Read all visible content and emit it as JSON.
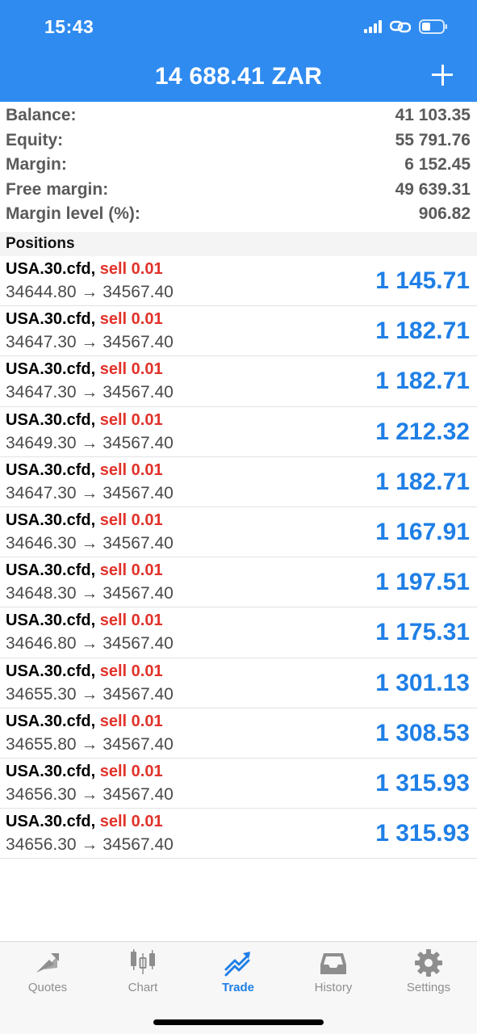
{
  "status_bar": {
    "time": "15:43"
  },
  "header": {
    "title": "14 688.41 ZAR",
    "add_icon": "plus-icon"
  },
  "summary": [
    {
      "label": "Balance:",
      "value": "41 103.35"
    },
    {
      "label": "Equity:",
      "value": "55 791.76"
    },
    {
      "label": "Margin:",
      "value": "6 152.45"
    },
    {
      "label": "Free margin:",
      "value": "49 639.31"
    },
    {
      "label": "Margin level (%):",
      "value": "906.82"
    }
  ],
  "positions_header": "Positions",
  "positions": [
    {
      "symbol": "USA.30.cfd,",
      "side": "sell 0.01",
      "prices": "34644.80 → 34567.40",
      "profit": "1 145.71"
    },
    {
      "symbol": "USA.30.cfd,",
      "side": "sell 0.01",
      "prices": "34647.30 → 34567.40",
      "profit": "1 182.71"
    },
    {
      "symbol": "USA.30.cfd,",
      "side": "sell 0.01",
      "prices": "34647.30 → 34567.40",
      "profit": "1 182.71"
    },
    {
      "symbol": "USA.30.cfd,",
      "side": "sell 0.01",
      "prices": "34649.30 → 34567.40",
      "profit": "1 212.32"
    },
    {
      "symbol": "USA.30.cfd,",
      "side": "sell 0.01",
      "prices": "34647.30 → 34567.40",
      "profit": "1 182.71"
    },
    {
      "symbol": "USA.30.cfd,",
      "side": "sell 0.01",
      "prices": "34646.30 → 34567.40",
      "profit": "1 167.91"
    },
    {
      "symbol": "USA.30.cfd,",
      "side": "sell 0.01",
      "prices": "34648.30 → 34567.40",
      "profit": "1 197.51"
    },
    {
      "symbol": "USA.30.cfd,",
      "side": "sell 0.01",
      "prices": "34646.80 → 34567.40",
      "profit": "1 175.31"
    },
    {
      "symbol": "USA.30.cfd,",
      "side": "sell 0.01",
      "prices": "34655.30 → 34567.40",
      "profit": "1 301.13"
    },
    {
      "symbol": "USA.30.cfd,",
      "side": "sell 0.01",
      "prices": "34655.80 → 34567.40",
      "profit": "1 308.53"
    },
    {
      "symbol": "USA.30.cfd,",
      "side": "sell 0.01",
      "prices": "34656.30 → 34567.40",
      "profit": "1 315.93"
    },
    {
      "symbol": "USA.30.cfd,",
      "side": "sell 0.01",
      "prices": "34656.30 → 34567.40",
      "profit": "1 315.93"
    }
  ],
  "tabs": [
    {
      "label": "Quotes",
      "icon": "quotes-icon",
      "active": false
    },
    {
      "label": "Chart",
      "icon": "chart-icon",
      "active": false
    },
    {
      "label": "Trade",
      "icon": "trade-icon",
      "active": true
    },
    {
      "label": "History",
      "icon": "history-icon",
      "active": false
    },
    {
      "label": "Settings",
      "icon": "settings-icon",
      "active": false
    }
  ],
  "colors": {
    "header_bg": "#2f8bf0",
    "profit": "#1f7fe6",
    "sell": "#e1322a",
    "tab_active": "#1f7fe6",
    "tab_inactive": "#8e8e8e"
  }
}
